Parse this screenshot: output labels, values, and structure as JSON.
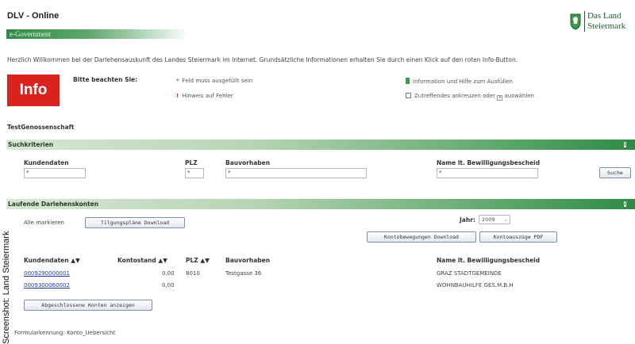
{
  "header": {
    "app_title": "DLV - Online",
    "subtitle": "e-Government",
    "logo_line1": "Das Land",
    "logo_line2": "Steiermark"
  },
  "intro_text": "Herzlich Willkommen bei der Darlehensauskunft des Landes Steiermark im Internet. Grundsätzliche Informationen erhalten Sie durch einen Klick auf den roten Info-Button.",
  "notes": {
    "info_button": "Info",
    "title": "Bitte beachten Sie:",
    "required_mark": "*",
    "required_text": "Feld muss ausgefüllt sein",
    "error_mark": "!",
    "error_text": "Hinweis auf Fehler",
    "info_text": "Information und Hilfe zum Ausfüllen",
    "check_text_1": "Zutreffendes ankreuzen oder",
    "check_text_2": "auswählen"
  },
  "company": "TestGenossenschaft",
  "search": {
    "section_title": "Suchkriterien",
    "labels": {
      "kundendaten": "Kundendaten",
      "plz": "PLZ",
      "bauvorhaben": "Bauvorhaben",
      "name": "Name lt. Bewilligungsbescheid"
    },
    "values": {
      "kundendaten": "*",
      "plz": "*",
      "bauvorhaben": "*",
      "name": "*"
    },
    "button": "Suche"
  },
  "accounts": {
    "section_title": "Laufende Darlehenskonten",
    "mark_all": "Alle markieren",
    "plan_download": "Tilgungspläne Download",
    "year_label": "Jahr:",
    "year_value": "2009",
    "movements_download": "Kontobewegungen Download",
    "statements_pdf": "Kontoauszüge PDF",
    "columns": {
      "kundendaten": "Kundendaten",
      "kontostand": "Kontostand",
      "plz": "PLZ",
      "bauvorhaben": "Bauvorhaben",
      "name": "Name lt. Bewilligungsbescheid"
    },
    "rows": [
      {
        "kundendaten": "0009290000001",
        "kontostand": "0,00",
        "plz": "8010",
        "bauvorhaben": "Testgasse 36",
        "name": "GRAZ STADTGEMEINDE"
      },
      {
        "kundendaten": "0009300060002",
        "kontostand": "0,00",
        "plz": "",
        "bauvorhaben": "",
        "name": "WOHNBAUHILFE GES.M.B.H"
      }
    ],
    "closed_accounts": "Abgeschlossene Konten anzeigen"
  },
  "form_id": "Formularkennung: Konto_Uebersicht",
  "watermark": "Screenshot: Land Steiermark",
  "colors": {
    "accent_green": "#2f8a45",
    "info_red": "#d8231f",
    "link_blue": "#1d3f9a"
  }
}
